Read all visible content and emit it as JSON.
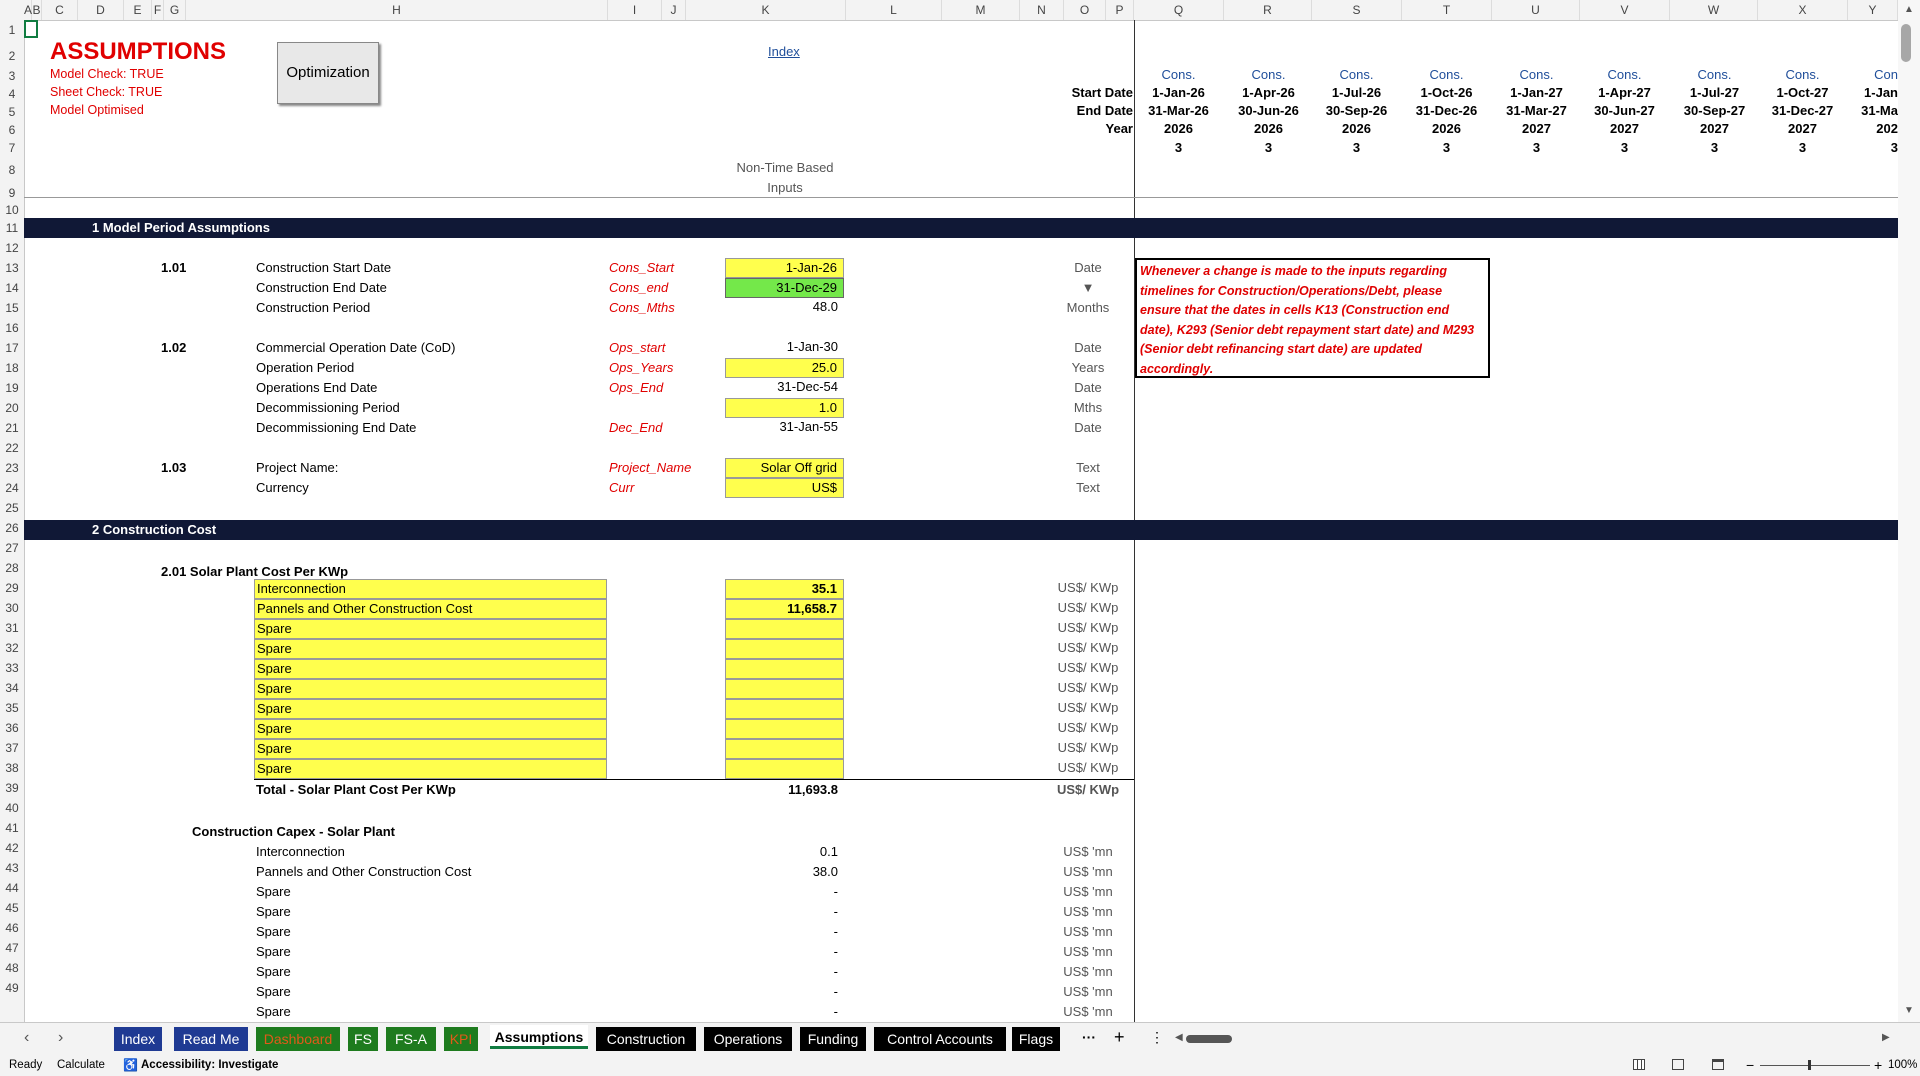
{
  "columns": [
    "A",
    "B",
    "C",
    "D",
    "E",
    "F",
    "G",
    "H",
    "I",
    "J",
    "K",
    "L",
    "M",
    "N",
    "O",
    "P",
    "Q",
    "R",
    "S",
    "T",
    "U",
    "V",
    "W",
    "X",
    "Y"
  ],
  "rows": [
    "1",
    "2",
    "3",
    "4",
    "5",
    "6",
    "7",
    "8",
    "9",
    "10",
    "11",
    "12",
    "13",
    "14",
    "15",
    "16",
    "17",
    "18",
    "19",
    "20",
    "21",
    "22",
    "23",
    "24",
    "25",
    "26",
    "27",
    "28",
    "29",
    "30",
    "31",
    "32",
    "33",
    "34",
    "35",
    "36",
    "37",
    "38",
    "39",
    "40",
    "41",
    "42",
    "43",
    "44",
    "45",
    "46",
    "47",
    "48",
    "49"
  ],
  "header": {
    "title": "ASSUMPTIONS",
    "model_check": "Model Check: TRUE",
    "sheet_check": "Sheet Check: TRUE",
    "model_optimised": "Model Optimised",
    "optimization_button": "Optimization",
    "index_link": "Index",
    "non_time_based_1": "Non-Time Based",
    "non_time_based_2": "Inputs",
    "start_date_label": "Start Date",
    "end_date_label": "End Date",
    "year_label": "Year"
  },
  "timeline": [
    {
      "type": "Cons.",
      "start": "1-Jan-26",
      "end": "31-Mar-26",
      "year": "2026",
      "months": "3"
    },
    {
      "type": "Cons.",
      "start": "1-Apr-26",
      "end": "30-Jun-26",
      "year": "2026",
      "months": "3"
    },
    {
      "type": "Cons.",
      "start": "1-Jul-26",
      "end": "30-Sep-26",
      "year": "2026",
      "months": "3"
    },
    {
      "type": "Cons.",
      "start": "1-Oct-26",
      "end": "31-Dec-26",
      "year": "2026",
      "months": "3"
    },
    {
      "type": "Cons.",
      "start": "1-Jan-27",
      "end": "31-Mar-27",
      "year": "2027",
      "months": "3"
    },
    {
      "type": "Cons.",
      "start": "1-Apr-27",
      "end": "30-Jun-27",
      "year": "2027",
      "months": "3"
    },
    {
      "type": "Cons.",
      "start": "1-Jul-27",
      "end": "30-Sep-27",
      "year": "2027",
      "months": "3"
    },
    {
      "type": "Cons.",
      "start": "1-Oct-27",
      "end": "31-Dec-27",
      "year": "2027",
      "months": "3"
    },
    {
      "type": "Con",
      "start": "1-Jan",
      "end": "31-Ma",
      "year": "202",
      "months": "3"
    }
  ],
  "sections": {
    "s1": "1  Model Period Assumptions",
    "s2": "2  Construction Cost"
  },
  "model_period": [
    {
      "id": "1.01",
      "label": "Construction Start Date",
      "name": "Cons_Start",
      "value": "1-Jan-26",
      "unit": "Date",
      "style": "yel"
    },
    {
      "id": "",
      "label": "Construction End Date",
      "name": "Cons_end",
      "value": "31-Dec-29",
      "unit": "▼",
      "style": "grn"
    },
    {
      "id": "",
      "label": "Construction Period",
      "name": "Cons_Mths",
      "value": "48.0",
      "unit": "Months",
      "style": ""
    },
    {
      "id": "1.02",
      "label": "Commercial Operation Date (CoD)",
      "name": "Ops_start",
      "value": "1-Jan-30",
      "unit": "Date",
      "style": ""
    },
    {
      "id": "",
      "label": "Operation Period",
      "name": "Ops_Years",
      "value": "25.0",
      "unit": "Years",
      "style": "yel"
    },
    {
      "id": "",
      "label": "Operations End Date",
      "name": "Ops_End",
      "value": "31-Dec-54",
      "unit": "Date",
      "style": ""
    },
    {
      "id": "",
      "label": "Decommissioning Period",
      "name": "",
      "value": "1.0",
      "unit": "Mths",
      "style": "yel"
    },
    {
      "id": "",
      "label": "Decommissioning End Date",
      "name": "Dec_End",
      "value": "31-Jan-55",
      "unit": "Date",
      "style": ""
    },
    {
      "id": "1.03",
      "label": "Project Name:",
      "name": "Project_Name",
      "value": "Solar Off grid",
      "unit": "Text",
      "style": "yel"
    },
    {
      "id": "",
      "label": "Currency",
      "name": "Curr",
      "value": "US$",
      "unit": "Text",
      "style": "yel"
    }
  ],
  "note": "Whenever a change is made to the inputs regarding timelines for Construction/Operations/Debt, please ensure that the dates in cells K13 (Construction end date), K293 (Senior debt repayment start date) and M293 (Senior debt refinancing start date) are updated accordingly.",
  "solar_cost": {
    "heading": "2.01  Solar Plant Cost Per KWp",
    "items": [
      {
        "label": "Interconnection",
        "value": "35.1",
        "unit": "US$/ KWp"
      },
      {
        "label": "Pannels and Other Construction Cost",
        "value": "11,658.7",
        "unit": "US$/ KWp"
      },
      {
        "label": "Spare",
        "value": "",
        "unit": "US$/ KWp"
      },
      {
        "label": "Spare",
        "value": "",
        "unit": "US$/ KWp"
      },
      {
        "label": "Spare",
        "value": "",
        "unit": "US$/ KWp"
      },
      {
        "label": "Spare",
        "value": "",
        "unit": "US$/ KWp"
      },
      {
        "label": "Spare",
        "value": "",
        "unit": "US$/ KWp"
      },
      {
        "label": "Spare",
        "value": "",
        "unit": "US$/ KWp"
      },
      {
        "label": "Spare",
        "value": "",
        "unit": "US$/ KWp"
      },
      {
        "label": "Spare",
        "value": "",
        "unit": "US$/ KWp"
      }
    ],
    "total": {
      "label": "Total - Solar Plant Cost Per KWp",
      "value": "11,693.8",
      "unit": "US$/ KWp"
    }
  },
  "capex": {
    "heading": "Construction Capex - Solar Plant",
    "items": [
      {
        "label": "Interconnection",
        "value": "0.1",
        "unit": "US$ 'mn"
      },
      {
        "label": "Pannels and Other Construction Cost",
        "value": "38.0",
        "unit": "US$ 'mn"
      },
      {
        "label": "Spare",
        "value": "-",
        "unit": "US$ 'mn"
      },
      {
        "label": "Spare",
        "value": "-",
        "unit": "US$ 'mn"
      },
      {
        "label": "Spare",
        "value": "-",
        "unit": "US$ 'mn"
      },
      {
        "label": "Spare",
        "value": "-",
        "unit": "US$ 'mn"
      },
      {
        "label": "Spare",
        "value": "-",
        "unit": "US$ 'mn"
      },
      {
        "label": "Spare",
        "value": "-",
        "unit": "US$ 'mn"
      },
      {
        "label": "Spare",
        "value": "-",
        "unit": "US$ 'mn"
      }
    ]
  },
  "tabs": [
    {
      "label": "Index",
      "bg": "#1f3a93",
      "fg": "#ffffff"
    },
    {
      "label": "Read Me",
      "bg": "#1f3a93",
      "fg": "#ffffff"
    },
    {
      "label": "Dashboard",
      "bg": "#1e7b1e",
      "fg": "#e05a1a"
    },
    {
      "label": "FS",
      "bg": "#1e7b1e",
      "fg": "#ffffff"
    },
    {
      "label": "FS-A",
      "bg": "#1e7b1e",
      "fg": "#ffffff"
    },
    {
      "label": "KPI",
      "bg": "#1e7b1e",
      "fg": "#e05a1a"
    },
    {
      "label": "Assumptions",
      "bg": "#ffffff",
      "fg": "#000000"
    },
    {
      "label": "Construction",
      "bg": "#000000",
      "fg": "#ffffff"
    },
    {
      "label": "Operations",
      "bg": "#000000",
      "fg": "#ffffff"
    },
    {
      "label": "Funding",
      "bg": "#000000",
      "fg": "#ffffff"
    },
    {
      "label": "Control Accounts",
      "bg": "#000000",
      "fg": "#ffffff"
    },
    {
      "label": "Flags",
      "bg": "#000000",
      "fg": "#ffffff"
    }
  ],
  "tab_more": "···",
  "tab_add": "+",
  "tab_menu": "⋮",
  "status": {
    "ready": "Ready",
    "calculate": "Calculate",
    "accessibility": "Accessibility: Investigate",
    "zoom": "100%"
  }
}
